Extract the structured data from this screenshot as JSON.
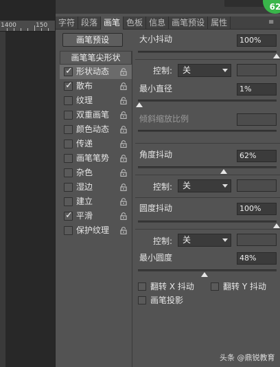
{
  "canvas": {
    "ruler_labels": [
      "1400",
      "150"
    ]
  },
  "badge": {
    "text": "62"
  },
  "tabs": [
    {
      "label": "字符",
      "active": false
    },
    {
      "label": "段落",
      "active": false
    },
    {
      "label": "画笔",
      "active": true
    },
    {
      "label": "色板",
      "active": false
    },
    {
      "label": "信息",
      "active": false
    },
    {
      "label": "画笔预设",
      "active": false
    },
    {
      "label": "属性",
      "active": false
    }
  ],
  "preset_button": "画笔预设",
  "list": {
    "header": "画笔笔尖形状",
    "items": [
      {
        "label": "形状动态",
        "checked": true,
        "selected": true
      },
      {
        "label": "散布",
        "checked": true,
        "selected": false
      },
      {
        "label": "纹理",
        "checked": false,
        "selected": false
      },
      {
        "label": "双重画笔",
        "checked": false,
        "selected": false
      },
      {
        "label": "颜色动态",
        "checked": false,
        "selected": false
      },
      {
        "label": "传递",
        "checked": false,
        "selected": false
      },
      {
        "label": "画笔笔势",
        "checked": false,
        "selected": false
      },
      {
        "label": "杂色",
        "checked": false,
        "selected": false
      },
      {
        "label": "湿边",
        "checked": false,
        "selected": false
      },
      {
        "label": "建立",
        "checked": false,
        "selected": false
      },
      {
        "label": "平滑",
        "checked": true,
        "selected": false
      },
      {
        "label": "保护纹理",
        "checked": false,
        "selected": false
      }
    ]
  },
  "settings": {
    "size_jitter": {
      "label": "大小抖动",
      "value": "100%",
      "slider": 1.0
    },
    "control1": {
      "label": "控制:",
      "value": "关"
    },
    "min_diameter": {
      "label": "最小直径",
      "value": "1%",
      "slider": 0.01
    },
    "tilt_scale": {
      "label": "倾斜缩放比例"
    },
    "angle_jitter": {
      "label": "角度抖动",
      "value": "62%",
      "slider": 0.62
    },
    "control2": {
      "label": "控制:",
      "value": "关"
    },
    "roundness_jitter": {
      "label": "圆度抖动",
      "value": "100%",
      "slider": 1.0
    },
    "control3": {
      "label": "控制:",
      "value": "关"
    },
    "min_roundness": {
      "label": "最小圆度",
      "value": "48%",
      "slider": 0.48
    },
    "flip_x": "翻转 X 抖动",
    "flip_y": "翻转 Y 抖动",
    "brush_projection": "画笔投影"
  },
  "watermark": "头条 @鼎锐教育"
}
